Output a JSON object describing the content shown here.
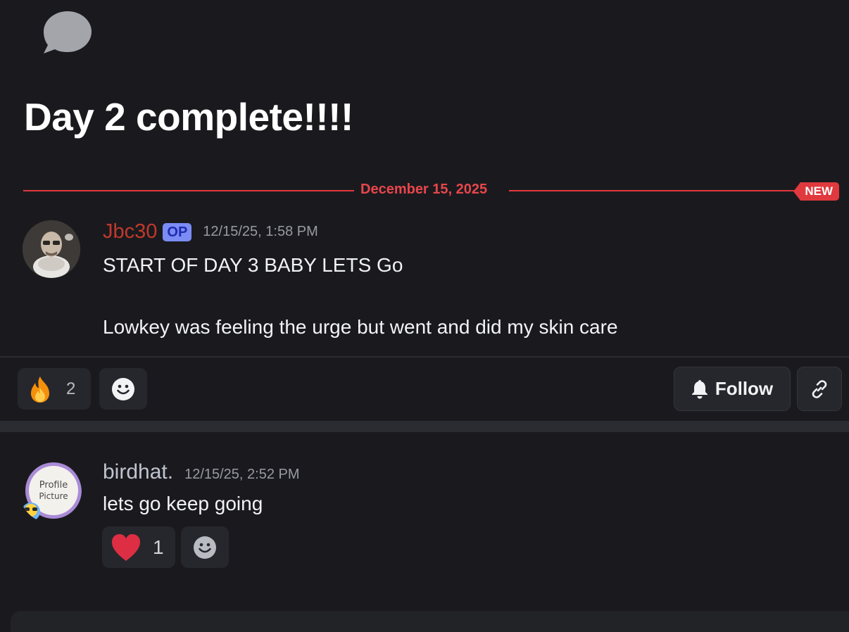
{
  "thread": {
    "icon": "speech-bubble-icon",
    "title": "Day 2 complete!!!!"
  },
  "divider": {
    "date": "December 15, 2025",
    "new_label": "NEW",
    "accent_color": "#e0393e"
  },
  "op_message": {
    "username": "Jbc30",
    "username_color": "#c0392b",
    "tag": "OP",
    "timestamp": "12/15/25, 1:58 PM",
    "lines": [
      "START OF DAY 3 BABY LETS Go",
      "Lowkey was feeling the urge but went and did my skin care"
    ],
    "reactions": [
      {
        "emoji": "fire-emoji",
        "count": "2"
      }
    ],
    "actions": {
      "follow_label": "Follow",
      "follow_icon": "bell-icon",
      "link_icon": "link-icon",
      "add_reaction_icon": "smiley-icon"
    }
  },
  "reply": {
    "username": "birdhat.",
    "timestamp": "12/15/25, 2:52 PM",
    "text": "lets go keep going",
    "avatar_caption": "Profile Picture",
    "reactions": [
      {
        "emoji": "heart-emoji",
        "count": "1"
      }
    ],
    "add_reaction_icon": "smiley-icon"
  }
}
